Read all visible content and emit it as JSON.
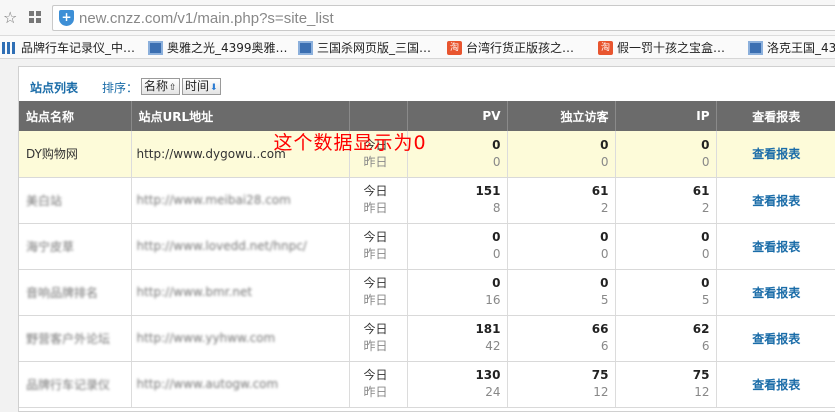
{
  "browser": {
    "url": "new.cnzz.com/v1/main.php?s=site_list",
    "bookmarks": [
      {
        "icon": "bar-chart-icon",
        "label": "品牌行车记录仪_中…"
      },
      {
        "icon": "page-icon",
        "label": "奥雅之光_4399奥雅…"
      },
      {
        "icon": "page-icon",
        "label": "三国杀网页版_三国…"
      },
      {
        "icon": "taobao-icon",
        "label": "台湾行货正版孩之…"
      },
      {
        "icon": "taobao-icon",
        "label": "假一罚十孩之宝盒…"
      },
      {
        "icon": "page-icon",
        "label": "洛克王国_4399"
      }
    ]
  },
  "panel": {
    "title": "站点列表",
    "sort_label": "排序：",
    "sort_name": "名称",
    "sort_time": "时间",
    "annotation": "这个数据显示为0"
  },
  "table": {
    "headers": {
      "name": "站点名称",
      "url": "站点URL地址",
      "pv": "PV",
      "uv": "独立访客",
      "ip": "IP",
      "report": "查看报表"
    },
    "today_label": "今日",
    "yesterday_label": "昨日",
    "rows": [
      {
        "name": "DY购物网",
        "url": "http://www.dygowu..com",
        "pv_today": "0",
        "pv_yesterday": "0",
        "uv_today": "0",
        "uv_yesterday": "0",
        "ip_today": "0",
        "ip_yesterday": "0",
        "report": "查看报表",
        "highlight": true,
        "blurred": false
      },
      {
        "name": "美白站",
        "url": "http://www.meibai28.com",
        "pv_today": "151",
        "pv_yesterday": "8",
        "uv_today": "61",
        "uv_yesterday": "2",
        "ip_today": "61",
        "ip_yesterday": "2",
        "report": "查看报表",
        "highlight": false,
        "blurred": true
      },
      {
        "name": "海宁皮草",
        "url": "http://www.lovedd.net/hnpc/",
        "pv_today": "0",
        "pv_yesterday": "0",
        "uv_today": "0",
        "uv_yesterday": "0",
        "ip_today": "0",
        "ip_yesterday": "0",
        "report": "查看报表",
        "highlight": false,
        "blurred": true
      },
      {
        "name": "音响品牌排名",
        "url": "http://www.bmr.net",
        "pv_today": "0",
        "pv_yesterday": "16",
        "uv_today": "0",
        "uv_yesterday": "5",
        "ip_today": "0",
        "ip_yesterday": "5",
        "report": "查看报表",
        "highlight": false,
        "blurred": true
      },
      {
        "name": "野营客户外论坛",
        "url": "http://www.yyhww.com",
        "pv_today": "181",
        "pv_yesterday": "42",
        "uv_today": "66",
        "uv_yesterday": "6",
        "ip_today": "62",
        "ip_yesterday": "6",
        "report": "查看报表",
        "highlight": false,
        "blurred": true
      },
      {
        "name": "品牌行车记录仪",
        "url": "http://www.autogw.com",
        "pv_today": "130",
        "pv_yesterday": "24",
        "uv_today": "75",
        "uv_yesterday": "12",
        "ip_today": "75",
        "ip_yesterday": "12",
        "report": "查看报表",
        "highlight": false,
        "blurred": true
      }
    ]
  }
}
